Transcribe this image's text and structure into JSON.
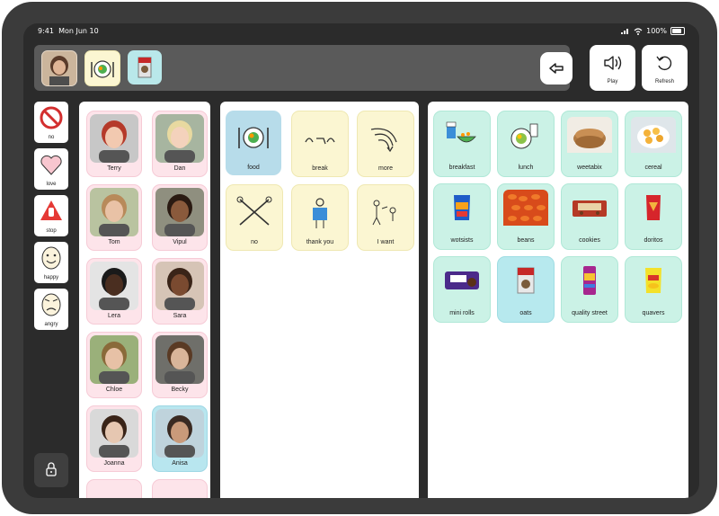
{
  "status_bar": {
    "time": "9:41",
    "date": "Mon Jun 10",
    "battery": "100%"
  },
  "sentence_bar": {
    "chips": [
      "person-photo",
      "food-symbol",
      "oats-product"
    ]
  },
  "controls": {
    "play_label": "Play",
    "refresh_label": "Refresh"
  },
  "quick_symbols": [
    {
      "label": "no",
      "icon": "no-entry-icon"
    },
    {
      "label": "love",
      "icon": "heart-icon"
    },
    {
      "label": "stop",
      "icon": "stop-hand-icon"
    },
    {
      "label": "happy",
      "icon": "happy-face-icon"
    },
    {
      "label": "angry",
      "icon": "angry-face-icon"
    }
  ],
  "people": [
    {
      "name": "Terry",
      "selected": false
    },
    {
      "name": "Dan",
      "selected": false
    },
    {
      "name": "Tom",
      "selected": false
    },
    {
      "name": "Vipul",
      "selected": false
    },
    {
      "name": "Lera",
      "selected": false
    },
    {
      "name": "Sara",
      "selected": false
    },
    {
      "name": "Chloe",
      "selected": false
    },
    {
      "name": "Becky",
      "selected": false
    },
    {
      "name": "Joanna",
      "selected": false
    },
    {
      "name": "Anisa",
      "selected": true
    }
  ],
  "categories": [
    {
      "label": "food",
      "selected": true,
      "icon": "plate-icon"
    },
    {
      "label": "break",
      "selected": false,
      "icon": "break-icon"
    },
    {
      "label": "more",
      "selected": false,
      "icon": "more-icon"
    },
    {
      "label": "no",
      "selected": false,
      "icon": "crossed-arms-icon"
    },
    {
      "label": "thank you",
      "selected": false,
      "icon": "thank-you-icon"
    },
    {
      "label": "I want",
      "selected": false,
      "icon": "i-want-icon"
    }
  ],
  "foods": [
    {
      "label": "breakfast",
      "icon": "breakfast-icon",
      "selected": false
    },
    {
      "label": "lunch",
      "icon": "lunch-icon",
      "selected": false
    },
    {
      "label": "weetabix",
      "icon": "weetabix-photo",
      "selected": false
    },
    {
      "label": "cereal",
      "icon": "cereal-photo",
      "selected": false
    },
    {
      "label": "wotsists",
      "icon": "wotsits-bag",
      "selected": false
    },
    {
      "label": "beans",
      "icon": "beans-photo",
      "selected": false
    },
    {
      "label": "cookies",
      "icon": "cookies-pack",
      "selected": false
    },
    {
      "label": "doritos",
      "icon": "doritos-bag",
      "selected": false
    },
    {
      "label": "mini rolls",
      "icon": "mini-rolls-pack",
      "selected": false
    },
    {
      "label": "oats",
      "icon": "oats-box",
      "selected": true
    },
    {
      "label": "quality street",
      "icon": "quality-street-tube",
      "selected": false
    },
    {
      "label": "quavers",
      "icon": "quavers-bag",
      "selected": false
    }
  ],
  "colors": {
    "frame": "#3b3b3b",
    "screen": "#2b2b2b",
    "people_tile": "#fde4ea",
    "category_tile": "#fbf6d2",
    "food_tile": "#cbf2e6",
    "selected_tile": "#b8e6ef"
  }
}
